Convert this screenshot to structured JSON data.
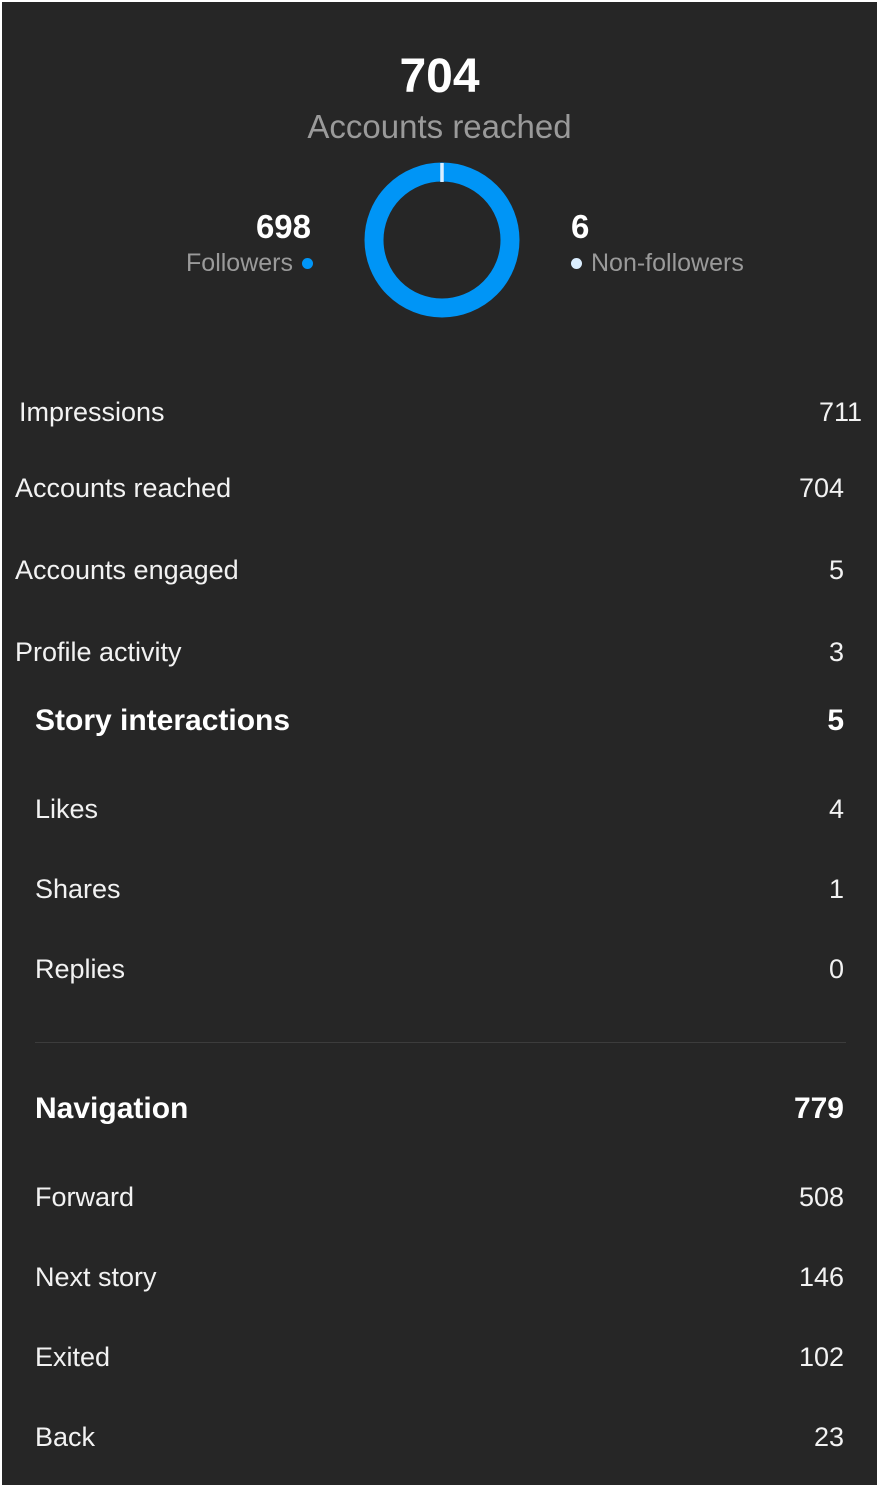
{
  "summary": {
    "accounts_reached_value": "704",
    "accounts_reached_label": "Accounts reached",
    "followers_value": "698",
    "followers_label": "Followers",
    "non_followers_value": "6",
    "non_followers_label": "Non-followers",
    "followers_share": 0.991,
    "non_followers_share": 0.009
  },
  "colors": {
    "background": "#262626",
    "followers": "#0095f6",
    "non_followers": "#dbeeff",
    "text_primary": "#ffffff",
    "text_secondary": "#9a9a9a"
  },
  "metrics": [
    {
      "label": "Impressions",
      "value": "711"
    },
    {
      "label": "Accounts reached",
      "value": "704"
    },
    {
      "label": "Accounts engaged",
      "value": "5"
    },
    {
      "label": "Profile activity",
      "value": "3"
    }
  ],
  "story_interactions": {
    "label": "Story interactions",
    "value": "5",
    "items": [
      {
        "label": "Likes",
        "value": "4"
      },
      {
        "label": "Shares",
        "value": "1"
      },
      {
        "label": "Replies",
        "value": "0"
      }
    ]
  },
  "navigation": {
    "label": "Navigation",
    "value": "779",
    "items": [
      {
        "label": "Forward",
        "value": "508"
      },
      {
        "label": "Next story",
        "value": "146"
      },
      {
        "label": "Exited",
        "value": "102"
      },
      {
        "label": "Back",
        "value": "23"
      }
    ]
  },
  "icons": {
    "followers_dot": "dot-icon",
    "non_followers_dot": "dot-icon"
  }
}
